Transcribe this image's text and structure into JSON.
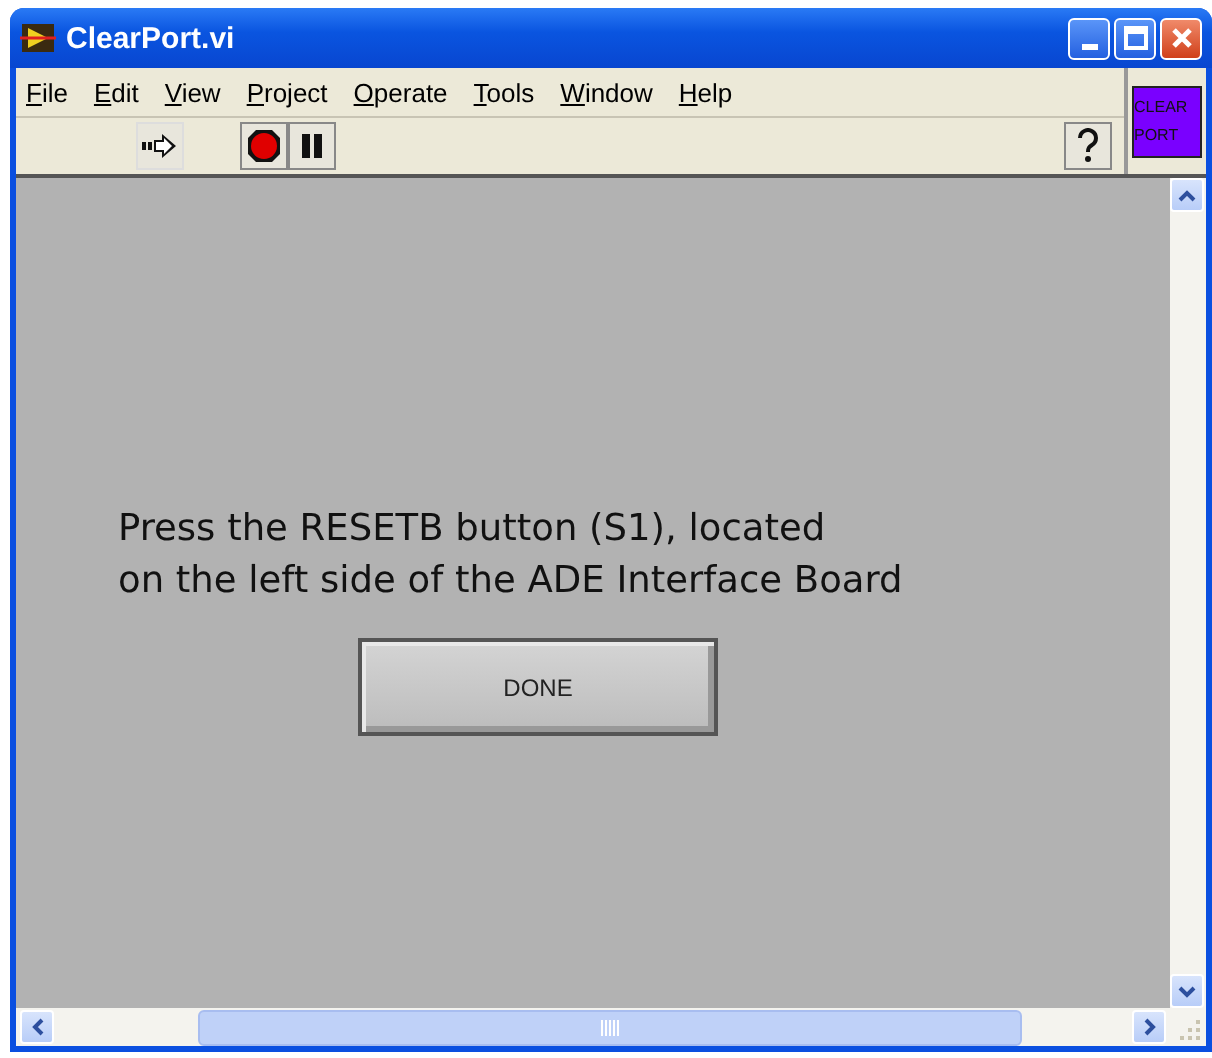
{
  "window": {
    "title": "ClearPort.vi"
  },
  "menu": [
    "File",
    "Edit",
    "View",
    "Project",
    "Operate",
    "Tools",
    "Window",
    "Help"
  ],
  "vi_icon": {
    "lines": [
      "CLEAR",
      "PORT"
    ]
  },
  "panel": {
    "message": [
      "Press the RESETB button (S1), located",
      "on the left side of the ADE Interface Board"
    ],
    "button": {
      "label": "DONE"
    }
  }
}
